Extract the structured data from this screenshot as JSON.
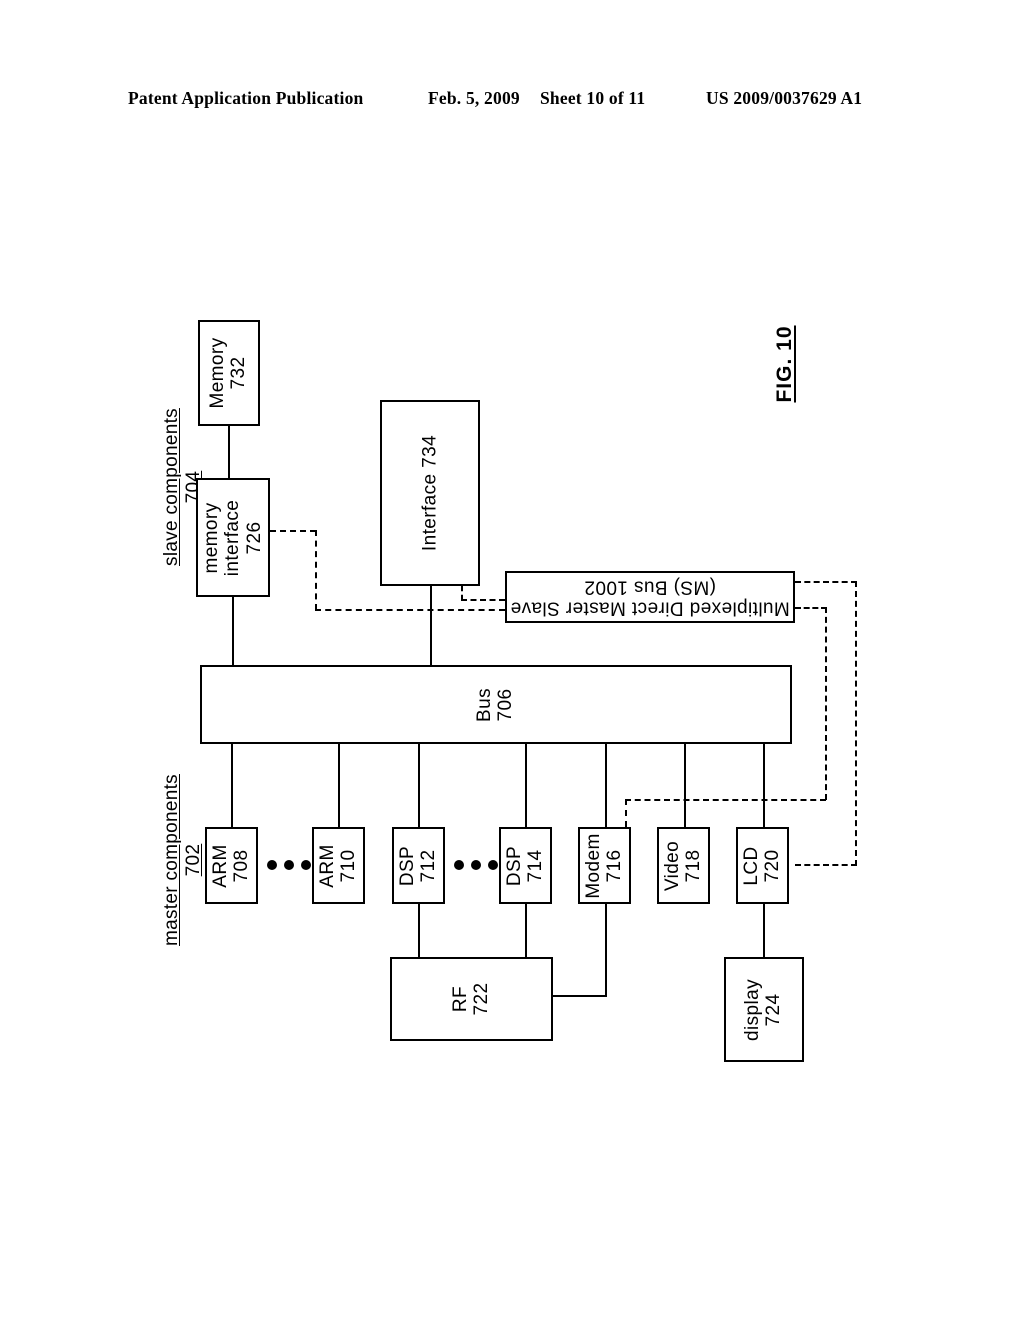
{
  "header": {
    "publication": "Patent Application Publication",
    "date": "Feb. 5, 2009",
    "sheet": "Sheet 10 of 11",
    "patent_number": "US 2009/0037629 A1"
  },
  "figure": {
    "label": "FIG. 10",
    "groups": [
      {
        "id": "slave",
        "name": "slave components",
        "ref": "704"
      },
      {
        "id": "master",
        "name": "master components",
        "ref": "702"
      }
    ],
    "blocks": {
      "memory": {
        "name": "Memory",
        "ref": "732"
      },
      "memory_interface": {
        "name": "memory",
        "name2": "interface",
        "ref": "726"
      },
      "interface": {
        "name": "Interface 734"
      },
      "ms_bus": {
        "line1": "Multiplexed Direct Master Slave",
        "line2": "(MS) Bus 1002"
      },
      "bus": {
        "name": "Bus",
        "ref": "706"
      },
      "arm_708": {
        "name": "ARM",
        "ref": "708"
      },
      "arm_710": {
        "name": "ARM",
        "ref": "710"
      },
      "dsp_712": {
        "name": "DSP",
        "ref": "712"
      },
      "dsp_714": {
        "name": "DSP",
        "ref": "714"
      },
      "modem_716": {
        "name": "Modem",
        "ref": "716"
      },
      "video_718": {
        "name": "Video",
        "ref": "718"
      },
      "lcd_720": {
        "name": "LCD",
        "ref": "720"
      },
      "rf_722": {
        "name": "RF",
        "ref": "722"
      },
      "display_724": {
        "name": "display",
        "ref": "724"
      }
    },
    "ellipsis_glyph": "•••"
  }
}
